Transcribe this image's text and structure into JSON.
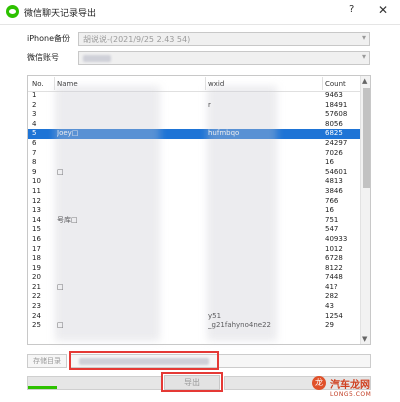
{
  "window": {
    "title": "微信聊天记录导出",
    "help_glyph": "?",
    "close_glyph": "✕"
  },
  "backup": {
    "label": "iPhone备份",
    "value": "胡说说-(2021/9/25 2.43 54)"
  },
  "account": {
    "label": "微信账号",
    "value": ""
  },
  "table": {
    "columns": {
      "no": "No.",
      "name": "Name",
      "wxid": "wxid",
      "count": "Count"
    },
    "rows": [
      {
        "no": "1",
        "name": "",
        "wxid": "",
        "count": "9463"
      },
      {
        "no": "2",
        "name": "",
        "wxid": "r",
        "count": "18491"
      },
      {
        "no": "3",
        "name": "",
        "wxid": "",
        "count": "57608"
      },
      {
        "no": "4",
        "name": "",
        "wxid": "",
        "count": "8056"
      },
      {
        "no": "5",
        "name": "Joey□",
        "wxid": "hufmbqo",
        "count": "6825"
      },
      {
        "no": "6",
        "name": "",
        "wxid": "",
        "count": "24297"
      },
      {
        "no": "7",
        "name": "",
        "wxid": "",
        "count": "7026"
      },
      {
        "no": "8",
        "name": "",
        "wxid": "",
        "count": "16"
      },
      {
        "no": "9",
        "name": "□",
        "wxid": "",
        "count": "54601"
      },
      {
        "no": "10",
        "name": "",
        "wxid": "",
        "count": "4813"
      },
      {
        "no": "11",
        "name": "",
        "wxid": "",
        "count": "3846"
      },
      {
        "no": "12",
        "name": "",
        "wxid": "",
        "count": "766"
      },
      {
        "no": "13",
        "name": "",
        "wxid": "",
        "count": "16"
      },
      {
        "no": "14",
        "name": "号库□",
        "wxid": "",
        "count": "751"
      },
      {
        "no": "15",
        "name": "",
        "wxid": "",
        "count": "547"
      },
      {
        "no": "16",
        "name": "",
        "wxid": "",
        "count": "40933"
      },
      {
        "no": "17",
        "name": "",
        "wxid": "",
        "count": "1012"
      },
      {
        "no": "18",
        "name": "",
        "wxid": "",
        "count": "6728"
      },
      {
        "no": "19",
        "name": "",
        "wxid": "",
        "count": "8122"
      },
      {
        "no": "20",
        "name": "",
        "wxid": "",
        "count": "7448"
      },
      {
        "no": "21",
        "name": "□",
        "wxid": "",
        "count": "41?"
      },
      {
        "no": "22",
        "name": "",
        "wxid": "",
        "count": "282"
      },
      {
        "no": "23",
        "name": "",
        "wxid": "",
        "count": "43"
      },
      {
        "no": "24",
        "name": "",
        "wxid": "y51",
        "count": "1254"
      },
      {
        "no": "25",
        "name": "□",
        "wxid": "_g21fahyno4ne22",
        "count": "29"
      }
    ],
    "selected_row": "5"
  },
  "footer": {
    "dir_label": "存储目录",
    "dir_value": "",
    "export_label": "导出",
    "progress_fraction": 0.22
  },
  "watermark": {
    "text": "汽车龙网",
    "sub": "LONG5.COM",
    "icon_glyph": "龙"
  },
  "colors": {
    "accent": "#1e74d6",
    "progress": "#2dc100",
    "highlight": "#e53935"
  }
}
